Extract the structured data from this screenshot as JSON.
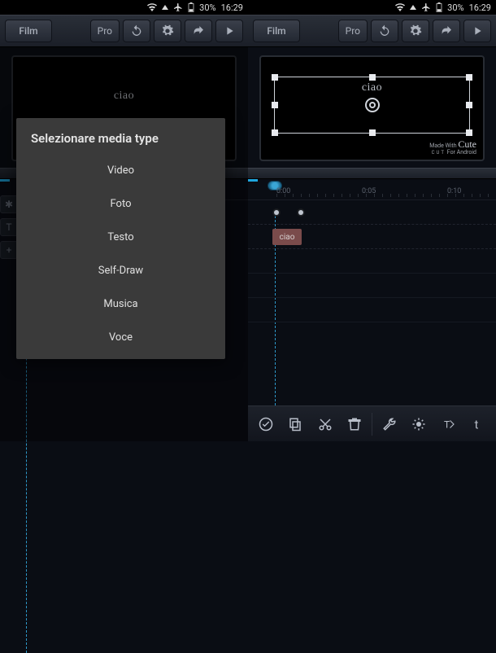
{
  "status": {
    "battery": "30%",
    "time": "16:29"
  },
  "toolbar": {
    "film": "Film",
    "pro": "Pro"
  },
  "preview": {
    "text": "ciao"
  },
  "watermark": {
    "line1": "Made With",
    "brand": "Cute",
    "sub": "CUT",
    "line2": "For Android"
  },
  "dialog": {
    "title": "Selezionare media type",
    "items": [
      "Video",
      "Foto",
      "Testo",
      "Self-Draw",
      "Musica",
      "Voce"
    ]
  },
  "ruler": {
    "labels": [
      {
        "pos": 35,
        "text": "0:00"
      },
      {
        "pos": 140,
        "text": "0:05"
      },
      {
        "pos": 245,
        "text": "0:10"
      }
    ]
  },
  "track": {
    "clip_label": "ciao"
  },
  "icons": {
    "gear": "gear-icon",
    "undo": "undo-icon",
    "share": "share-icon",
    "play": "play-icon",
    "check": "check-icon",
    "copy": "copy-icon",
    "cut": "cut-icon",
    "trash": "trash-icon",
    "wrench": "wrench-icon",
    "brightness": "brightness-icon",
    "text": "text-tool-icon",
    "letter": "letter-icon"
  }
}
